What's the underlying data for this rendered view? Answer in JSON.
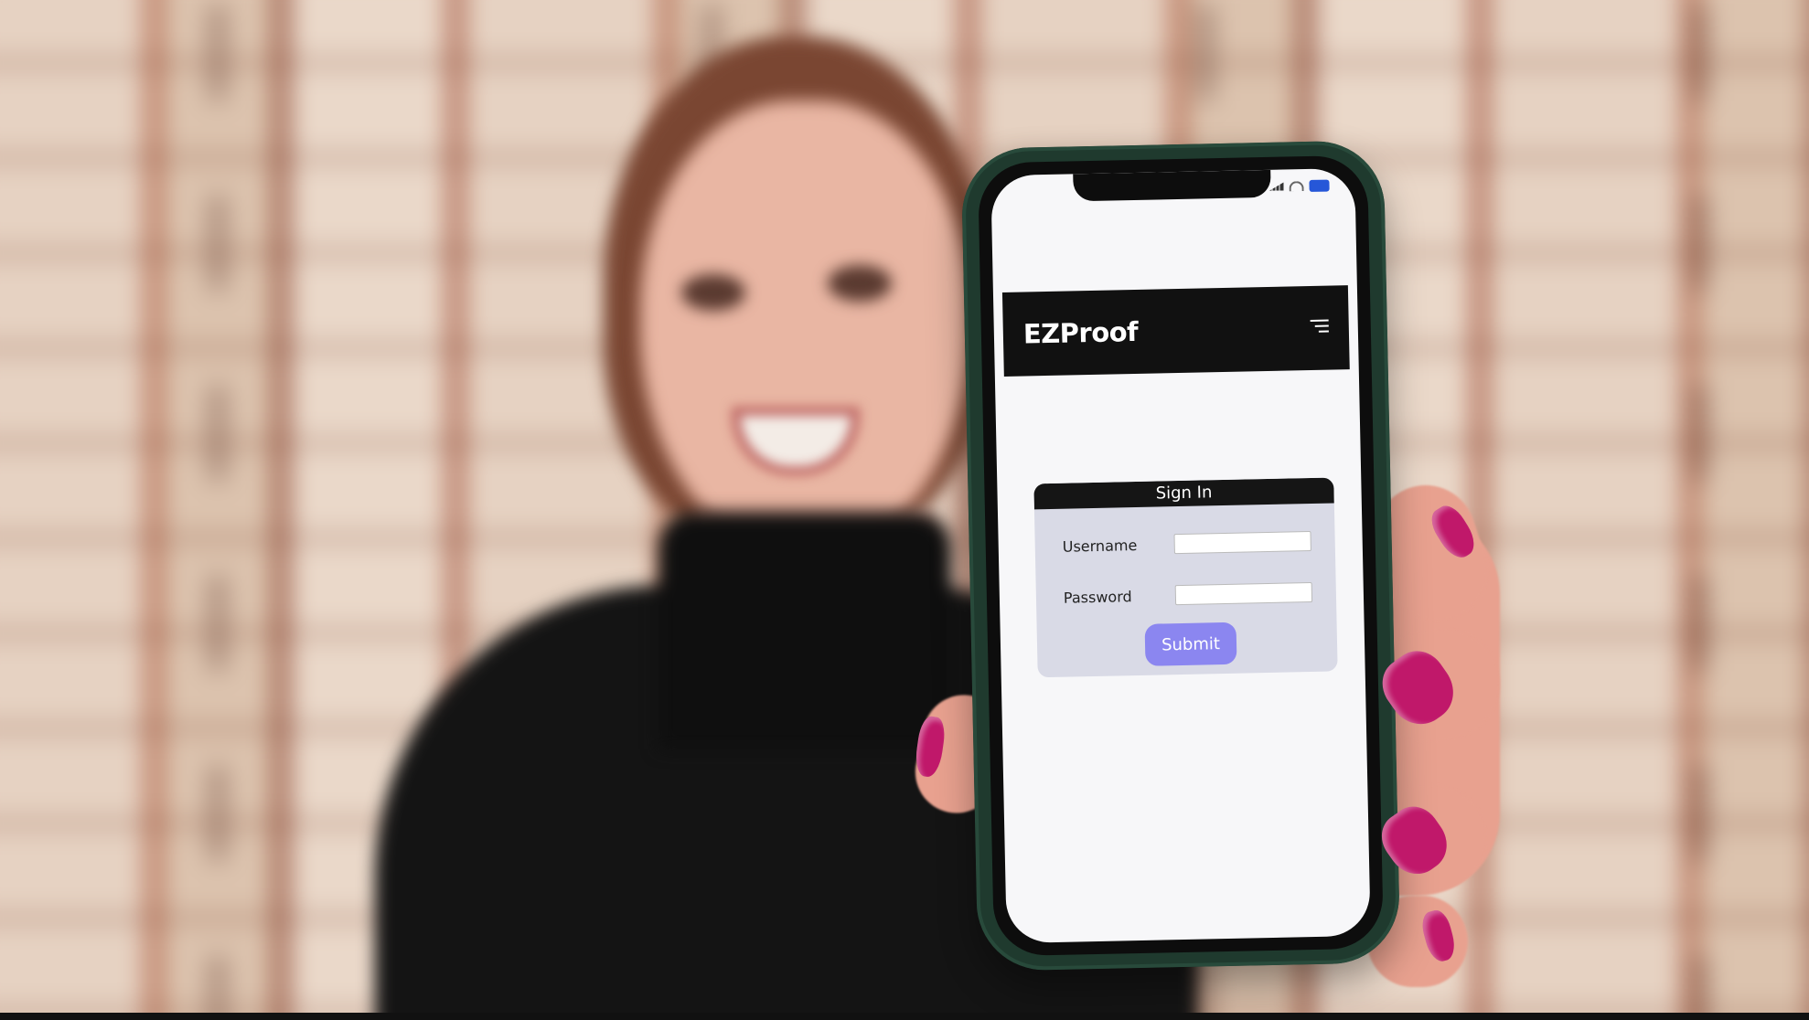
{
  "app": {
    "brand": "EZProof",
    "menu_icon": "hamburger-menu-icon"
  },
  "signin": {
    "title": "Sign In",
    "username_label": "Username",
    "username_value": "",
    "password_label": "Password",
    "password_value": "",
    "submit_label": "Submit"
  },
  "colors": {
    "header": "#111111",
    "card": "#d9dae6",
    "submit": "#8b86f0",
    "phone_case": "#1f3a2e",
    "nail": "#c0186a"
  }
}
